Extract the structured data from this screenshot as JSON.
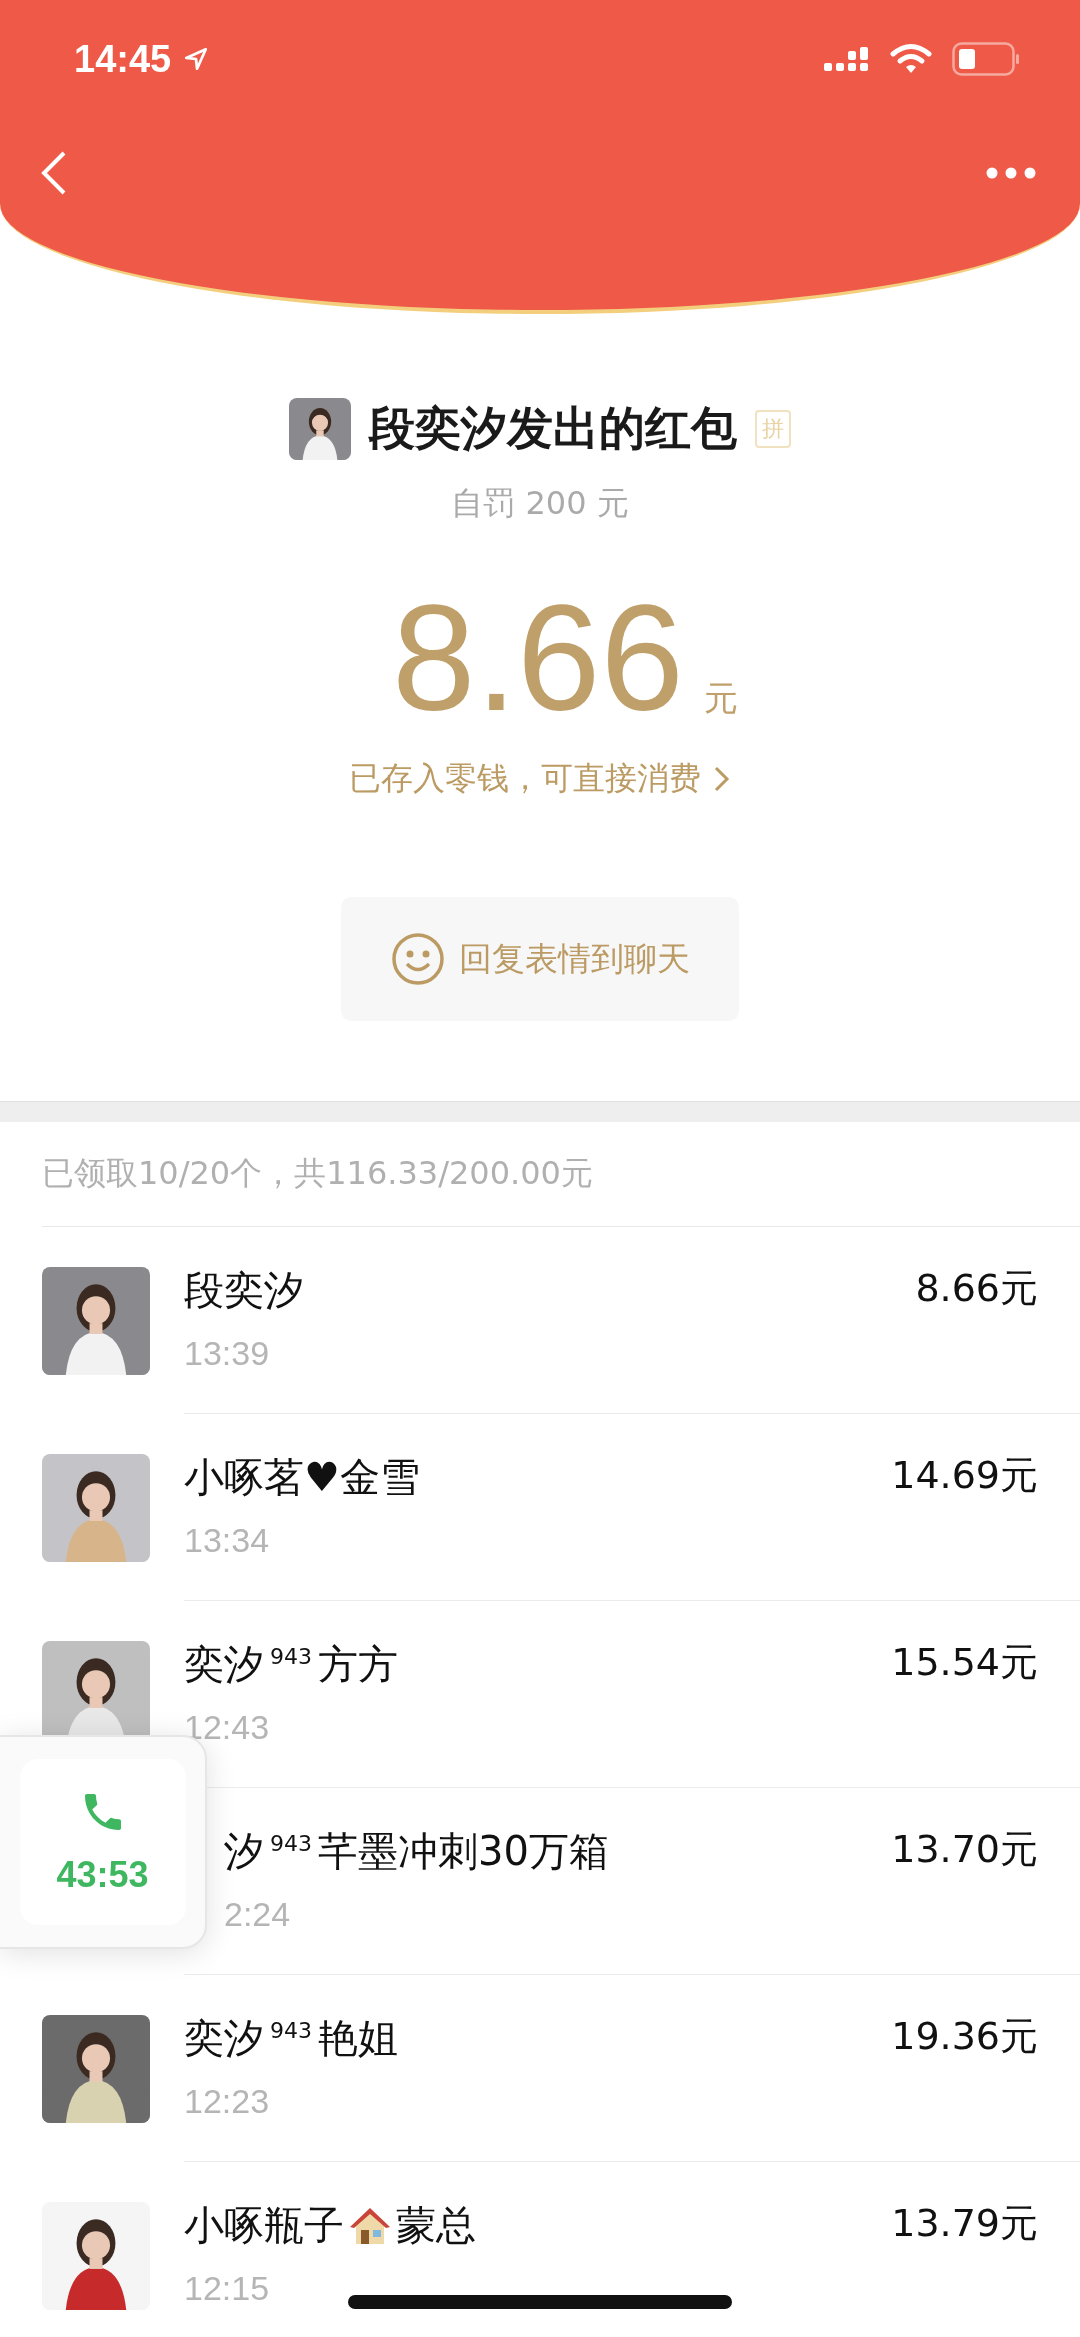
{
  "status_bar": {
    "time": "14:45"
  },
  "envelope": {
    "title": "段奕汐发出的红包",
    "badge": "拼",
    "subtitle": "自罚 200 元",
    "amount": "8.66",
    "unit": "元",
    "notice": "已存入零钱，可直接消费",
    "reply_button": "回复表情到聊天"
  },
  "summary": "已领取10/20个，共116.33/200.00元",
  "rows": [
    {
      "kind": "plain",
      "name": "段奕汐",
      "time": "13:39",
      "amount": "8.66元"
    },
    {
      "kind": "plain",
      "name": "小啄茗♥金雪",
      "time": "13:34",
      "amount": "14.69元"
    },
    {
      "kind": "plain",
      "name": "奕汐$^{943}$方方",
      "time": "12:43",
      "amount": "15.54元"
    },
    {
      "kind": "covered",
      "name": "汐$^{943}$芊墨冲刺30万箱",
      "time": "2:24",
      "amount": "13.70元"
    },
    {
      "kind": "plain",
      "name": "奕汐$^{943}$艳姐",
      "time": "12:23",
      "amount": "19.36元"
    },
    {
      "kind": "house",
      "name": "小啄瓶子",
      "name_after": "蒙总",
      "time": "12:15",
      "amount": "13.79元"
    }
  ],
  "call_widget": {
    "duration": "43:53"
  }
}
